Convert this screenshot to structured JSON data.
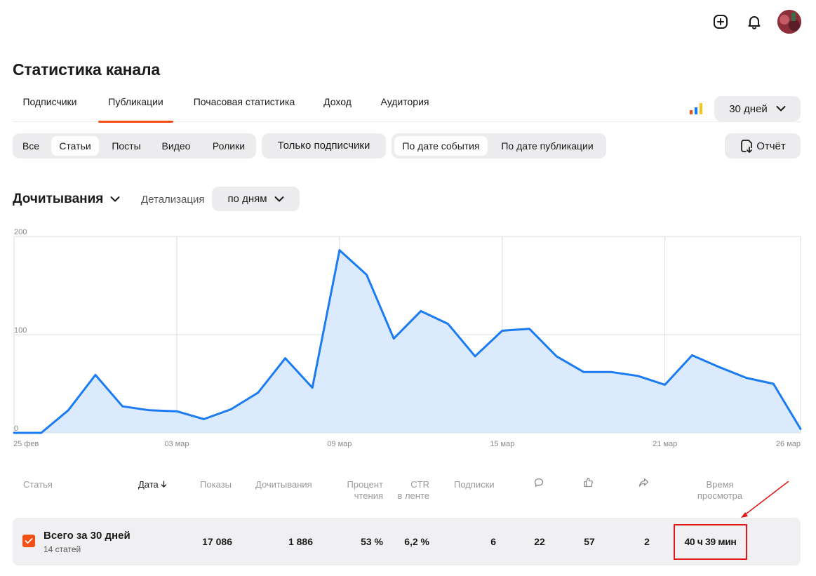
{
  "header": {
    "icons": [
      "plus-square-icon",
      "bell-icon"
    ],
    "title": "Статистика канала"
  },
  "tabs": [
    {
      "label": "Подписчики",
      "active": false
    },
    {
      "label": "Публикации",
      "active": true
    },
    {
      "label": "Почасовая статистика",
      "active": false
    },
    {
      "label": "Доход",
      "active": false
    },
    {
      "label": "Аудитория",
      "active": false
    }
  ],
  "period": {
    "label": "30 дней"
  },
  "content_filter": {
    "items": [
      {
        "label": "Все",
        "active": false
      },
      {
        "label": "Статьи",
        "active": true
      },
      {
        "label": "Посты",
        "active": false
      },
      {
        "label": "Видео",
        "active": false
      },
      {
        "label": "Ролики",
        "active": false
      }
    ]
  },
  "subscribers_filter": {
    "label": "Только подписчики"
  },
  "date_filter": {
    "items": [
      {
        "label": "По дате события",
        "active": true
      },
      {
        "label": "По дате публикации",
        "active": false
      }
    ]
  },
  "report_button": {
    "label": "Отчёт"
  },
  "metric": {
    "label": "Дочитывания",
    "detail_label": "Детализация",
    "detail_value": "по дням"
  },
  "colors": {
    "accent": "#f24f16",
    "line": "#1a7bf2",
    "area": "#d9e9fc",
    "annotation": "#e01818"
  },
  "chart_data": {
    "type": "area",
    "title": "",
    "xlabel": "",
    "ylabel": "",
    "ylim": [
      0,
      200
    ],
    "yticks": [
      "0",
      "100",
      "200"
    ],
    "grid": true,
    "x_tick_labels": [
      {
        "label": "25 фев",
        "index": 0
      },
      {
        "label": "03 мар",
        "index": 6
      },
      {
        "label": "09 мар",
        "index": 12
      },
      {
        "label": "15 мар",
        "index": 18
      },
      {
        "label": "21 мар",
        "index": 24
      },
      {
        "label": "26 мар",
        "index": 29
      }
    ],
    "x": [
      "25 фев",
      "26 фев",
      "27 фев",
      "28 фев",
      "01 мар",
      "02 мар",
      "03 мар",
      "04 мар",
      "05 мар",
      "06 мар",
      "07 мар",
      "08 мар",
      "09 мар",
      "10 мар",
      "11 мар",
      "12 мар",
      "13 мар",
      "14 мар",
      "15 мар",
      "16 мар",
      "17 мар",
      "18 мар",
      "19 мар",
      "20 мар",
      "21 мар",
      "22 мар",
      "23 мар",
      "24 мар",
      "25 мар",
      "26 мар"
    ],
    "series": [
      {
        "values": [
          0,
          0,
          23,
          59,
          27,
          23,
          22,
          14,
          24,
          41,
          76,
          46,
          186,
          161,
          96,
          124,
          111,
          78,
          104,
          106,
          78,
          62,
          62,
          58,
          49,
          79,
          67,
          56,
          50,
          4
        ]
      }
    ]
  },
  "table": {
    "columns": [
      {
        "label": "Статья"
      },
      {
        "label": "Дата"
      },
      {
        "label": "Показы"
      },
      {
        "label": "Дочитывания"
      },
      {
        "label": "Процент",
        "label2": "чтения"
      },
      {
        "label": "CTR",
        "label2": "в ленте"
      },
      {
        "label": "Подписки"
      },
      {
        "icon": "comment-icon"
      },
      {
        "icon": "thumb-up-icon"
      },
      {
        "icon": "share-icon"
      },
      {
        "label": "Время",
        "label2": "просмотра"
      }
    ],
    "total_row": {
      "checked": true,
      "title": "Всего за 30 дней",
      "subtitle": "14 статей",
      "impressions": "17 086",
      "reads": "1 886",
      "read_percent": "53 %",
      "ctr": "6,2 %",
      "subscriptions": "6",
      "comments": "22",
      "likes": "57",
      "shares": "2",
      "view_time": "40 ч 39 мин"
    }
  }
}
